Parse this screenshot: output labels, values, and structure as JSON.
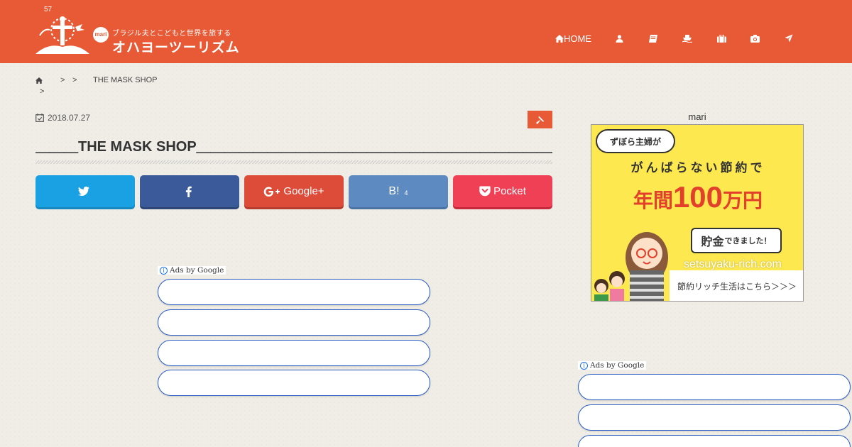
{
  "header": {
    "counter": "57",
    "logo_tag": "ブラジル夫とこどもと世界を旅する",
    "logo_title": "オハヨーツーリズム",
    "logo_mari": "mari",
    "nav": [
      {
        "label": "HOME",
        "icon": "home-icon"
      },
      {
        "label": "",
        "icon": "user-icon"
      },
      {
        "label": "",
        "icon": "book-icon"
      },
      {
        "label": "",
        "icon": "ship-icon"
      },
      {
        "label": "",
        "icon": "suitcase-icon"
      },
      {
        "label": "",
        "icon": "camera-icon"
      },
      {
        "label": "",
        "icon": "plane-icon"
      }
    ]
  },
  "breadcrumb": {
    "sep1": ">",
    "sep2": ">",
    "current": "THE MASK SHOP",
    "sep3": ">"
  },
  "article": {
    "date": "2018.07.27",
    "title": "＿＿＿THE MASK SHOP＿＿＿＿＿＿＿＿＿＿＿＿＿＿＿＿＿＿＿＿＿＿＿＿＿＿＿＿＿＿＿＿＿"
  },
  "share": {
    "twitter": "",
    "facebook": "",
    "google": "Google+",
    "hatena": "B!",
    "hatena_count": "4",
    "pocket": "Pocket"
  },
  "ads": {
    "label": "Ads by Google",
    "info": "i"
  },
  "sidebar": {
    "title": "mari",
    "banner": {
      "bubble": "ずぼら主婦が",
      "line1": "がんばらない節約で",
      "line2_a": "年間",
      "line2_b": "100",
      "line2_c": "万円",
      "speech_a": "貯金",
      "speech_b": "できました！",
      "url": "setsuyaku-rich.com",
      "footer": "節約リッチ生活はこちら＞＞＞"
    }
  },
  "colors": {
    "brand": "#e85a36",
    "twitter": "#1aa1e3",
    "facebook": "#3b5a9a",
    "google": "#dd4b39",
    "hatena": "#5d8ac1",
    "pocket": "#ef4056",
    "ad_border": "#2b5fc4"
  }
}
